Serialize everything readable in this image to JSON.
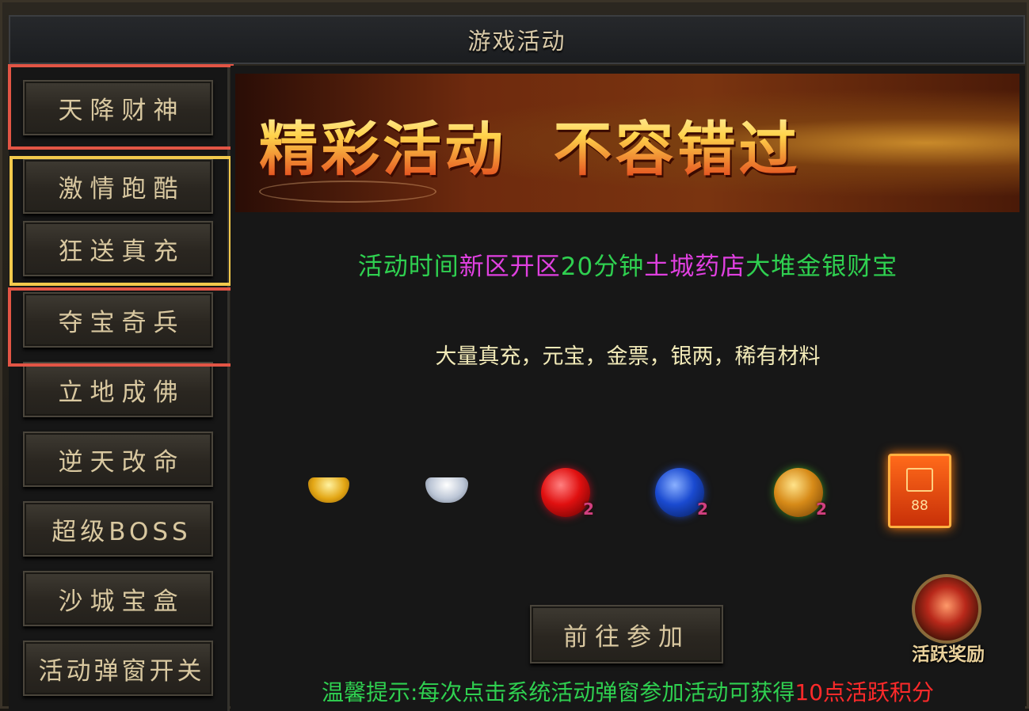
{
  "window": {
    "title": "游戏活动"
  },
  "sidebar": {
    "items": [
      {
        "label": "天降财神"
      },
      {
        "label": "激情跑酷"
      },
      {
        "label": "狂送真充"
      },
      {
        "label": "夺宝奇兵"
      },
      {
        "label": "立地成佛"
      },
      {
        "label": "逆天改命"
      },
      {
        "label": "超级BOSS"
      },
      {
        "label": "沙城宝盒"
      },
      {
        "label": "活动弹窗开关"
      }
    ]
  },
  "banner": {
    "heading": "精彩活动  不容错过"
  },
  "info": {
    "segments": [
      "活动时间",
      "新区开区",
      "20分钟",
      "土城药店",
      "大堆金银财宝"
    ],
    "rewards_text": "大量真充，元宝，金票，银两，稀有材料"
  },
  "rewards": {
    "items": [
      {
        "icon": "gold-ingot-icon"
      },
      {
        "icon": "silver-ingot-icon"
      },
      {
        "icon": "red-orb-icon",
        "badge": "2"
      },
      {
        "icon": "blue-orb-icon",
        "badge": "2"
      },
      {
        "icon": "gold-orb-icon",
        "badge": "2"
      },
      {
        "icon": "red-card-icon",
        "value": "88"
      }
    ]
  },
  "actions": {
    "go_label": "前往参加",
    "active_reward_label": "活跃奖励"
  },
  "tip": {
    "prefix": "温馨提示:每次点击系统活动弹窗参加活动可获得",
    "highlight": "10点活跃积分"
  },
  "colors": {
    "green": "#2fd050",
    "magenta": "#e040e0",
    "red": "#ff2a2a",
    "highlight_red": "#e25545",
    "highlight_yellow": "#f2c94c"
  }
}
